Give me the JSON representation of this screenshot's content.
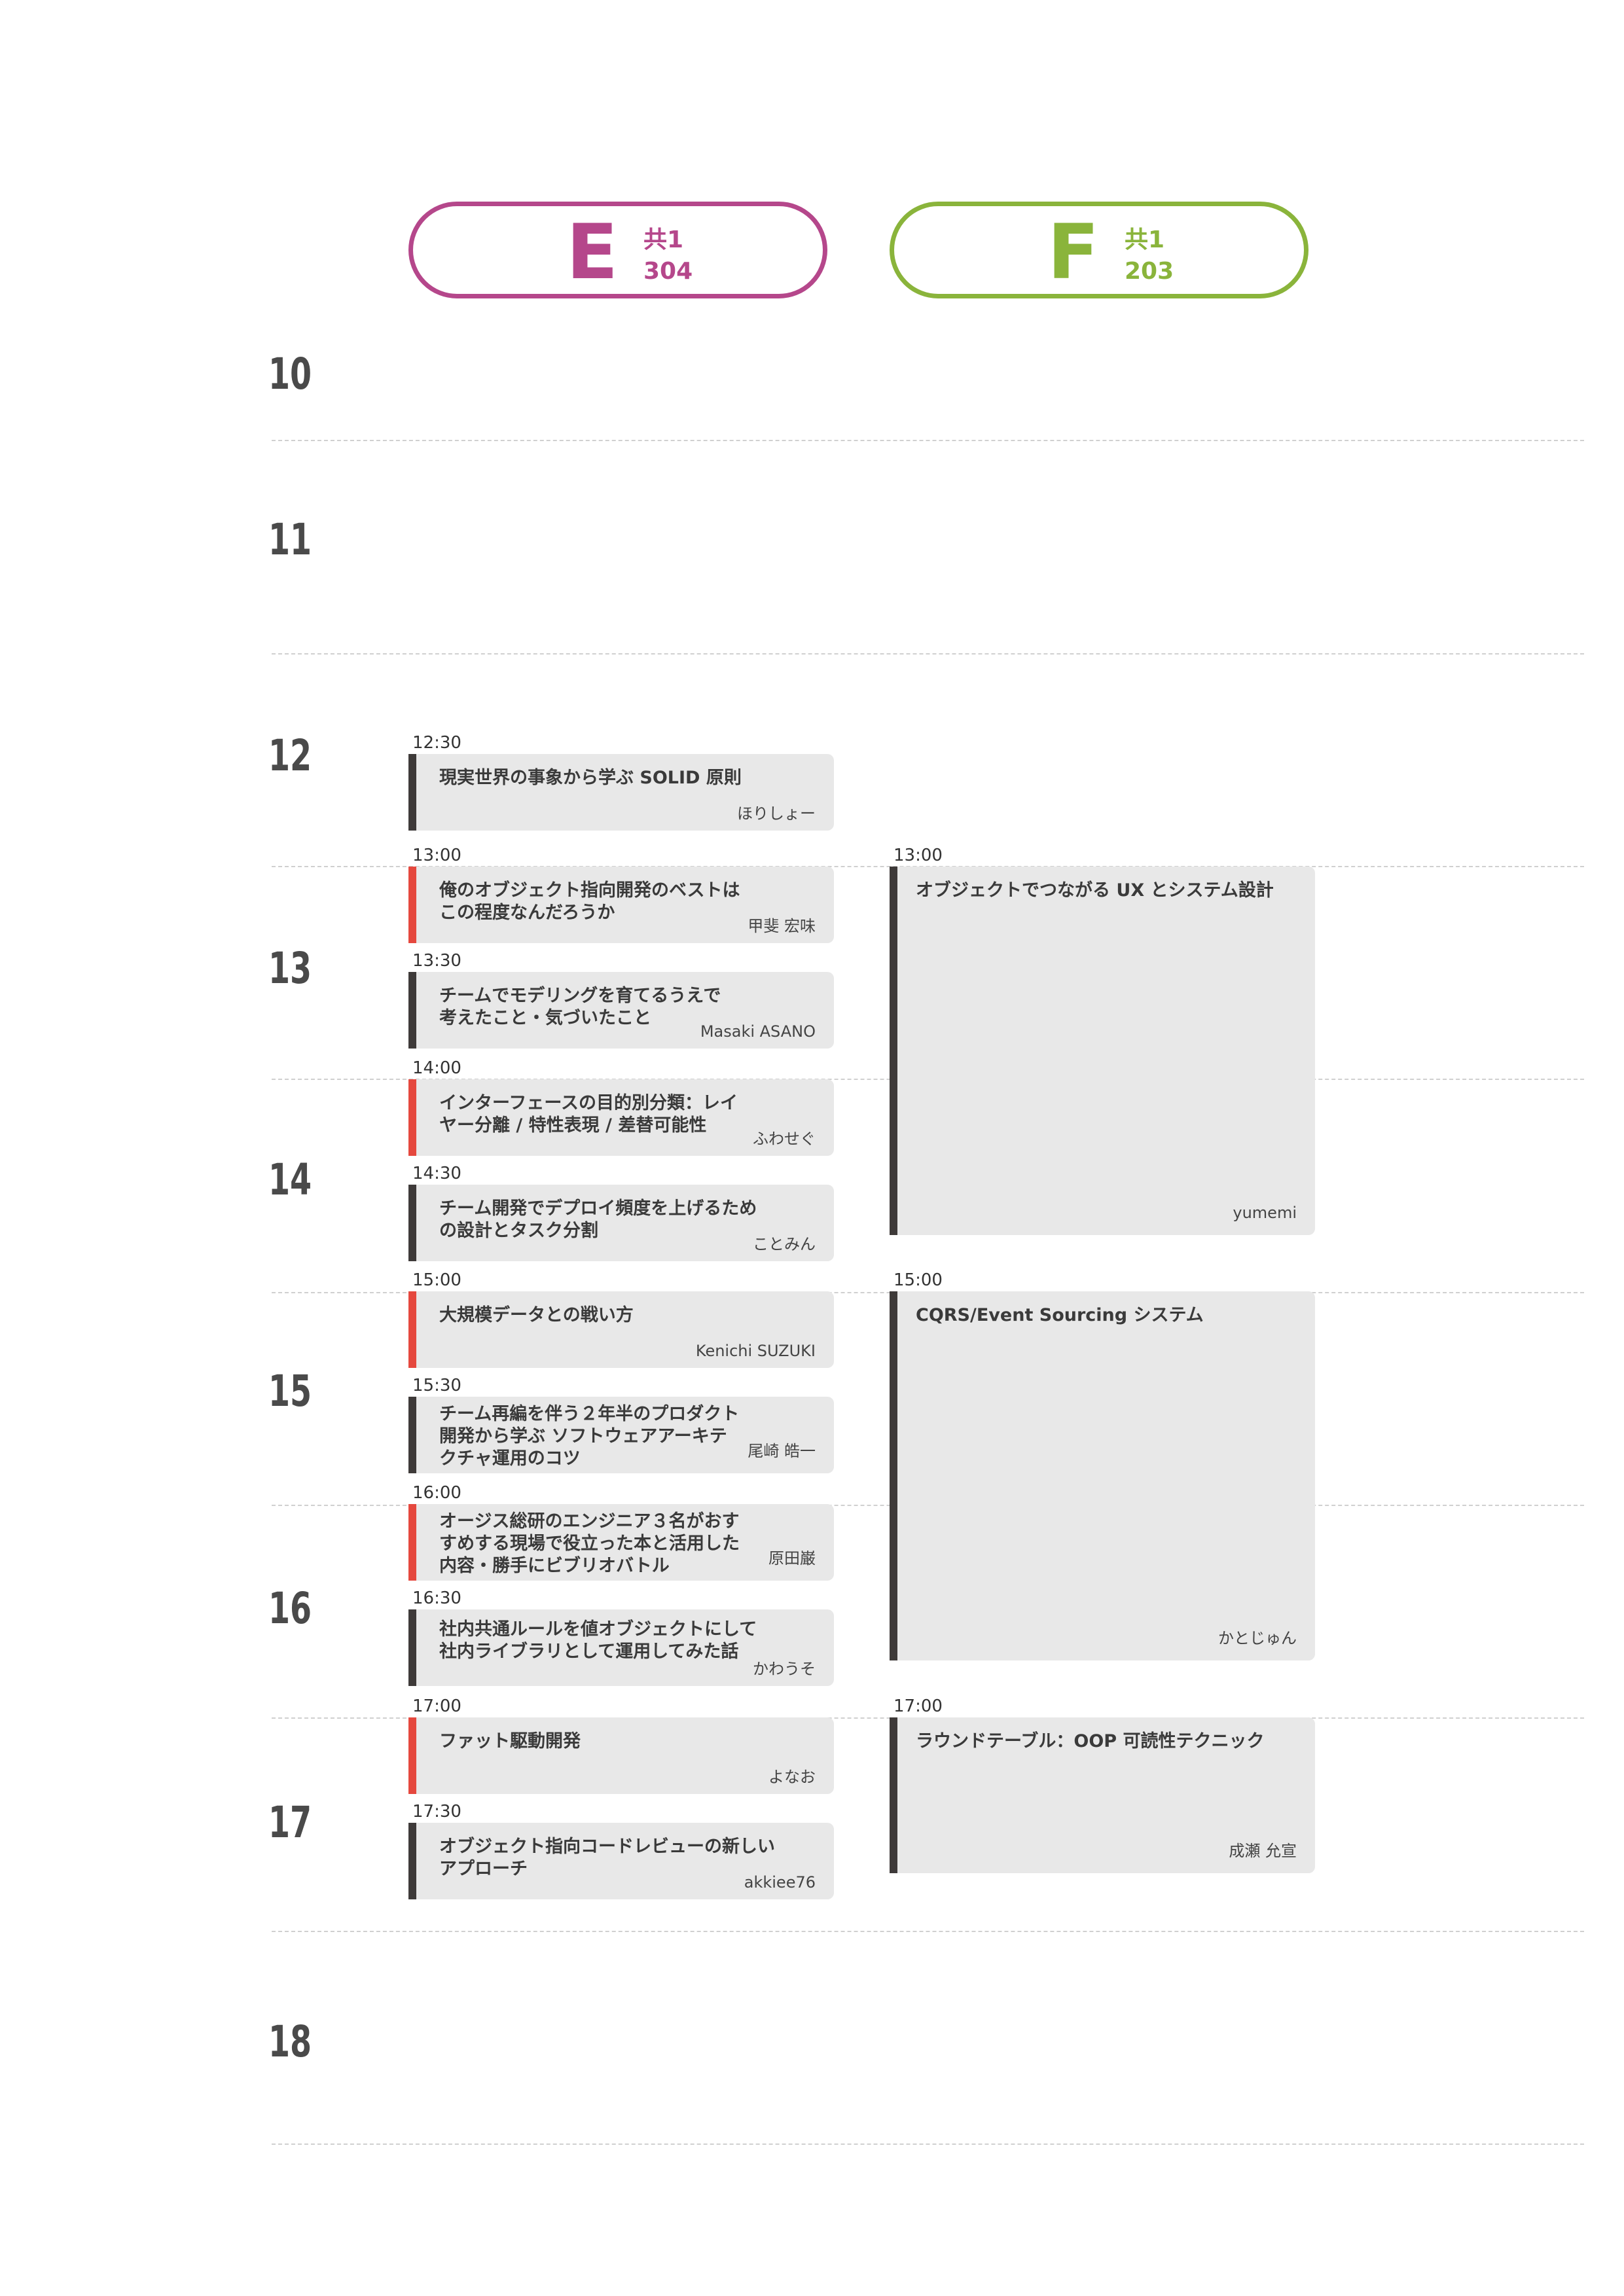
{
  "colors": {
    "room_e": "#b5478b",
    "room_f": "#8ab43b",
    "accent_bar": "#e5483e",
    "dark_bar": "#3e3a39",
    "card_bg": "#e8e8e8"
  },
  "rooms": [
    {
      "letter": "E",
      "building": "共1",
      "number": "304"
    },
    {
      "letter": "F",
      "building": "共1",
      "number": "203"
    }
  ],
  "hours": [
    "10",
    "11",
    "12",
    "13",
    "14",
    "15",
    "16",
    "17",
    "18"
  ],
  "room_e_sessions": [
    {
      "time": "12:30",
      "title": "現実世界の事象から学ぶ SOLID 原則",
      "speaker": "ほりしょー",
      "accent": false
    },
    {
      "time": "13:00",
      "title": "俺のオブジェクト指向開発のベストは\nこの程度なんだろうか",
      "speaker": "甲斐 宏味",
      "accent": true
    },
    {
      "time": "13:30",
      "title": "チームでモデリングを育てるうえで\n考えたこと・気づいたこと",
      "speaker": "Masaki ASANO",
      "accent": false
    },
    {
      "time": "14:00",
      "title": "インターフェースの目的別分類：レイ\nヤー分離 / 特性表現 / 差替可能性",
      "speaker": "ふわせぐ",
      "accent": true
    },
    {
      "time": "14:30",
      "title": "チーム開発でデプロイ頻度を上げるため\nの設計とタスク分割",
      "speaker": "ことみん",
      "accent": false
    },
    {
      "time": "15:00",
      "title": "大規模データとの戦い方",
      "speaker": "Kenichi SUZUKI",
      "accent": true
    },
    {
      "time": "15:30",
      "title": "チーム再編を伴う２年半のプロダクト\n開発から学ぶ ソフトウェアアーキテ\nクチャ運用のコツ",
      "speaker": "尾崎 皓一",
      "accent": false
    },
    {
      "time": "16:00",
      "title": "オージス総研のエンジニア３名がおす\nすめする現場で役立った本と活用した\n内容・勝手にビブリオバトル",
      "speaker": "原田巌",
      "accent": true
    },
    {
      "time": "16:30",
      "title": "社内共通ルールを値オブジェクトにして\n社内ライブラリとして運用してみた話",
      "speaker": "かわうそ",
      "accent": false
    },
    {
      "time": "17:00",
      "title": "ファット駆動開発",
      "speaker": "よなお",
      "accent": true
    },
    {
      "time": "17:30",
      "title": "オブジェクト指向コードレビューの新しい\nアプローチ",
      "speaker": "akkiee76",
      "accent": false
    }
  ],
  "room_f_sessions": [
    {
      "time": "13:00",
      "title": "オブジェクトでつながる UX とシステム設計",
      "speaker": "yumemi",
      "accent": false
    },
    {
      "time": "15:00",
      "title": "CQRS/Event Sourcing システム",
      "speaker": "かとじゅん",
      "accent": false
    },
    {
      "time": "17:00",
      "title": "ラウンドテーブル：OOP 可読性テクニック",
      "speaker": "成瀬 允宣",
      "accent": false
    }
  ]
}
